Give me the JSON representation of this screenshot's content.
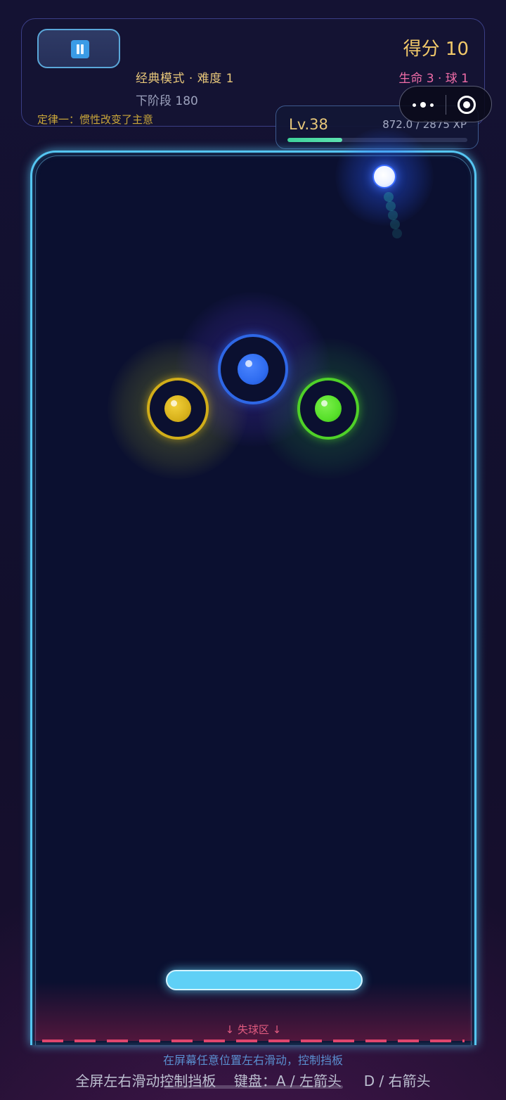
{
  "hud": {
    "score": "得分 10",
    "mode": "经典模式 · 难度 1",
    "lives_balls": "生命 3 · 球 1",
    "next_stage": "下阶段 180",
    "law": "定律一：惯性改变了主意"
  },
  "xp": {
    "level": "Lv.38",
    "values": "872.0 / 2875 XP",
    "progress_fraction": 0.303
  },
  "bumpers": [
    {
      "name": "yellow",
      "color": "#d8b21c",
      "ring": "#d1ad19",
      "glow": "rgba(170,185,40,0.38)"
    },
    {
      "name": "blue",
      "color": "#2f6cf0",
      "ring": "#2e67e6",
      "glow": "rgba(80,50,200,0.42)"
    },
    {
      "name": "green",
      "color": "#57e02a",
      "ring": "#4fd128",
      "glow": "rgba(40,150,60,0.38)"
    }
  ],
  "colors": {
    "field_border": "#55c6f2",
    "paddle": "#5fd0f6",
    "ball": "#ffffff",
    "danger": "#e0466d"
  },
  "danger_zone": {
    "label": "↓  失球区  ↓"
  },
  "hints": {
    "swipe": "在屏幕任意位置左右滑动，控制挡板",
    "controls": "全屏左右滑动控制挡板    键盘：A / 左箭头     D / 右箭头"
  },
  "capsule": {
    "more_icon": "more-dots-icon",
    "close_icon": "target-close-icon"
  }
}
